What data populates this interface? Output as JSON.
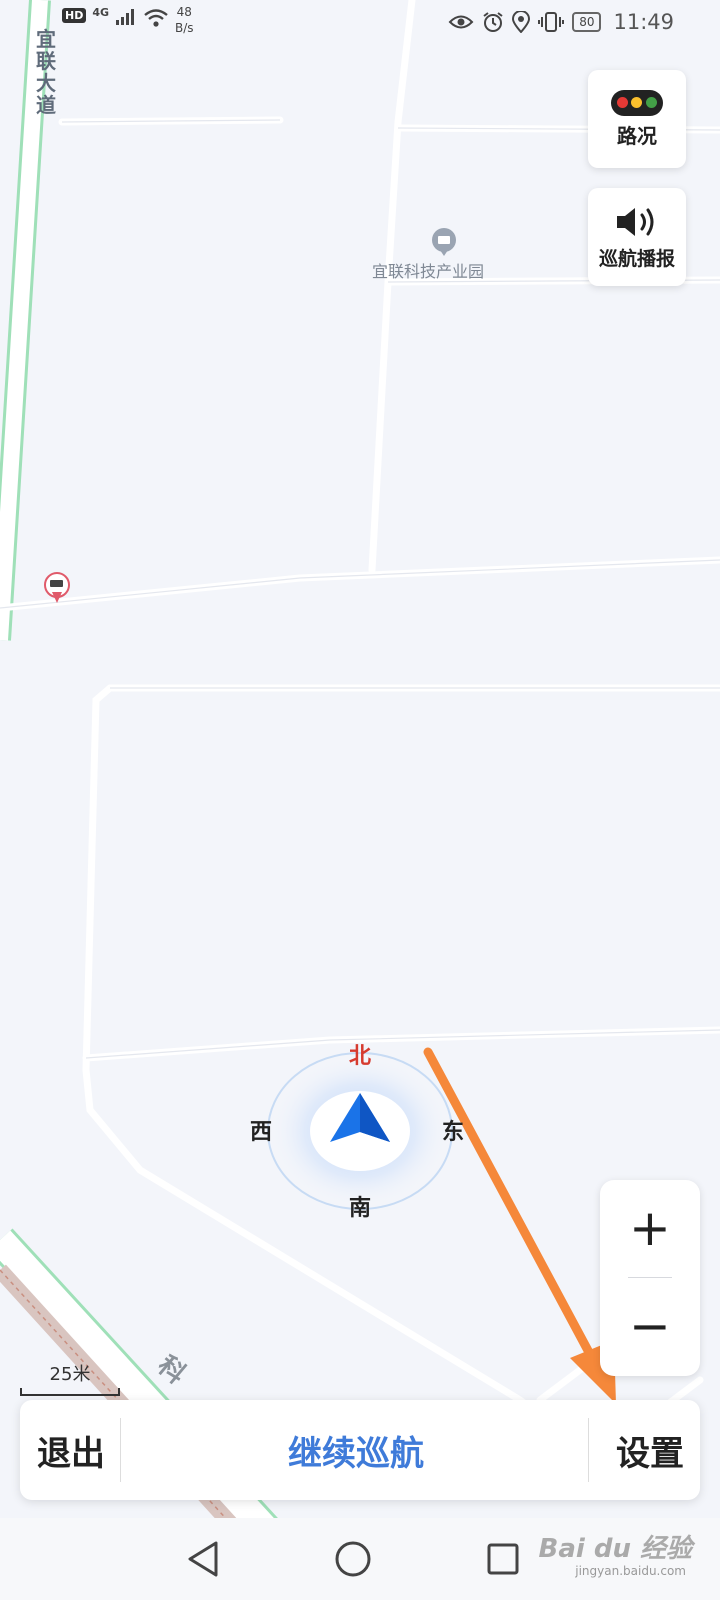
{
  "status_bar": {
    "hd": "HD",
    "network": "4G",
    "speed_value": "48",
    "speed_unit": "B/s",
    "battery": "80",
    "time": "11:49"
  },
  "map": {
    "road_name": "宜联大道",
    "poi_label": "宜联科技产业园",
    "road_lower": "科"
  },
  "compass": {
    "north": "北",
    "south": "南",
    "east": "东",
    "west": "西"
  },
  "traffic_button": {
    "label": "路况",
    "colors": [
      "#e53935",
      "#fbc02d",
      "#43a047"
    ]
  },
  "voice_button": {
    "label": "巡航播报"
  },
  "zoom": {
    "in_label": "+",
    "out_label": "−"
  },
  "scale": {
    "label": "25米"
  },
  "bottom_bar": {
    "exit_label": "退出",
    "continue_label": "继续巡航",
    "settings_label": "设置"
  },
  "watermark": {
    "text": "Bai du 经验",
    "sub": "jingyan.baidu.com"
  },
  "colors": {
    "accent": "#3f7bd9",
    "arrow": "#f5883a",
    "nav_arrow": "#1a73e8"
  }
}
